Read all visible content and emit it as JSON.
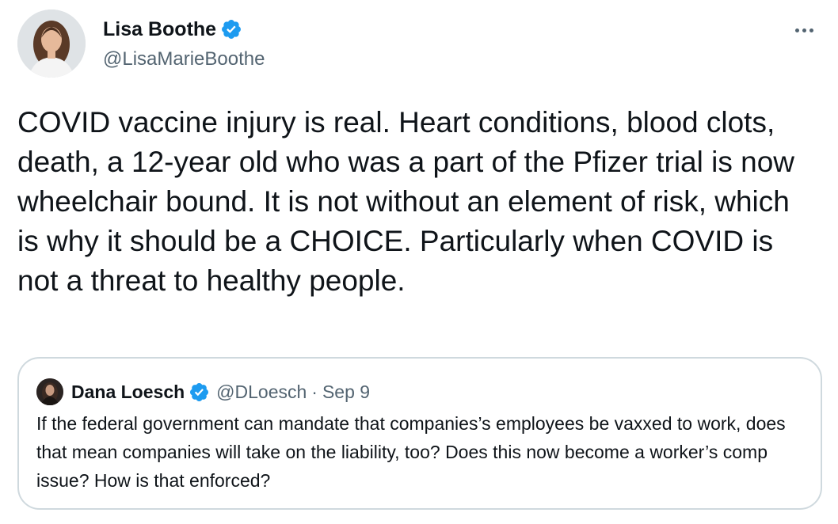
{
  "tweet": {
    "author": {
      "display_name": "Lisa Boothe",
      "handle": "@LisaMarieBoothe",
      "verified": true,
      "avatar_icon": "profile-photo"
    },
    "more_icon": "more-horizontal-icon",
    "text": "COVID vaccine injury is real. Heart conditions, blood clots, death, a 12-year old who was a part of the Pfizer trial is now wheelchair bound. It is not without an element of risk, which is why it should be a CHOICE. Particularly when COVID is not a threat to healthy people."
  },
  "quoted_tweet": {
    "author": {
      "display_name": "Dana Loesch",
      "handle": "@DLoesch",
      "verified": true,
      "avatar_icon": "profile-photo"
    },
    "separator": "·",
    "date": "Sep 9",
    "text": "If the federal government can mandate that companies’s employees be vaxxed to work, does that mean companies will take on the liability, too? Does this now become a worker’s comp issue? How is that enforced?"
  },
  "colors": {
    "text_primary": "#0f1419",
    "text_secondary": "#536471",
    "verified_blue": "#1d9bf0",
    "border": "#cfd9de",
    "background": "#ffffff"
  }
}
